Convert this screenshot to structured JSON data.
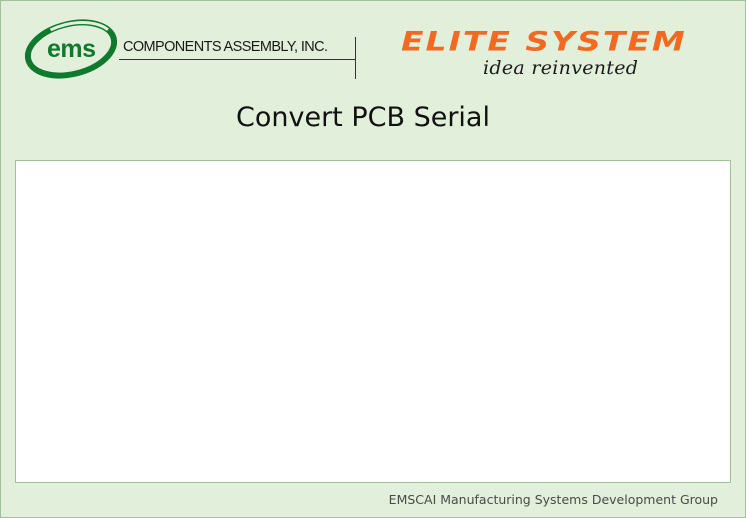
{
  "header": {
    "ems_logo": {
      "mark": "ems",
      "company_name": "COMPONENTS ASSEMBLY, INC."
    },
    "elite_logo": {
      "name": "ELITE SYSTEM",
      "tagline": "idea reinvented"
    }
  },
  "title": "Convert PCB Serial",
  "content": {},
  "footer": {
    "text": "EMSCAI Manufacturing Systems Development Group"
  },
  "colors": {
    "window_background": "#e2efda",
    "panel_background": "#ffffff",
    "panel_border": "#9cc497",
    "ems_green": "#0f7a2e",
    "elite_orange": "#f26a22"
  }
}
